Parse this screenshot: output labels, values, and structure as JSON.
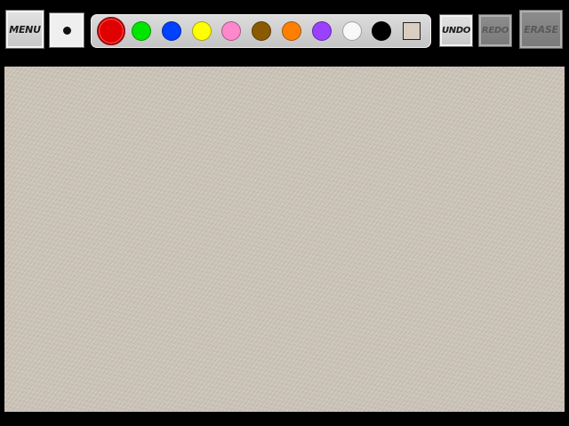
{
  "toolbar": {
    "menu_label": "MENU",
    "undo_label": "UNDO",
    "redo_label": "REDO",
    "erase_label": "ERASE",
    "brush_icon": "brush-size-dot-icon"
  },
  "palette": {
    "selected": "red",
    "colors": [
      {
        "name": "red",
        "hex": "#e00000"
      },
      {
        "name": "green",
        "hex": "#00e600"
      },
      {
        "name": "blue",
        "hex": "#0040ff"
      },
      {
        "name": "yellow",
        "hex": "#ffff00"
      },
      {
        "name": "pink",
        "hex": "#ff88cc"
      },
      {
        "name": "brown",
        "hex": "#8b5a00"
      },
      {
        "name": "orange",
        "hex": "#ff8000"
      },
      {
        "name": "purple",
        "hex": "#9a40ff"
      },
      {
        "name": "white",
        "hex": "#f8f8f8"
      },
      {
        "name": "black",
        "hex": "#000000"
      },
      {
        "name": "canvas-color",
        "hex": "#d9cfc0"
      }
    ]
  },
  "state": {
    "redo_enabled": false,
    "erase_enabled": false
  }
}
